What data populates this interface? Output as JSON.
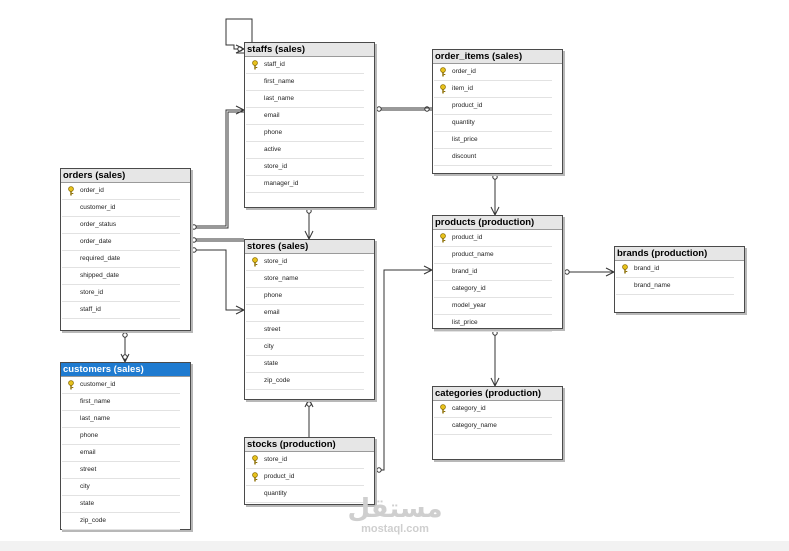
{
  "diagram": {
    "tables": [
      {
        "id": "staffs",
        "title": "staffs (sales)",
        "selected": false,
        "columns": [
          {
            "name": "staff_id",
            "pk": true
          },
          {
            "name": "first_name",
            "pk": false
          },
          {
            "name": "last_name",
            "pk": false
          },
          {
            "name": "email",
            "pk": false
          },
          {
            "name": "phone",
            "pk": false
          },
          {
            "name": "active",
            "pk": false
          },
          {
            "name": "store_id",
            "pk": false
          },
          {
            "name": "manager_id",
            "pk": false
          }
        ]
      },
      {
        "id": "order_items",
        "title": "order_items (sales)",
        "selected": false,
        "columns": [
          {
            "name": "order_id",
            "pk": true
          },
          {
            "name": "item_id",
            "pk": true
          },
          {
            "name": "product_id",
            "pk": false
          },
          {
            "name": "quantity",
            "pk": false
          },
          {
            "name": "list_price",
            "pk": false
          },
          {
            "name": "discount",
            "pk": false
          }
        ]
      },
      {
        "id": "orders",
        "title": "orders (sales)",
        "selected": false,
        "columns": [
          {
            "name": "order_id",
            "pk": true
          },
          {
            "name": "customer_id",
            "pk": false
          },
          {
            "name": "order_status",
            "pk": false
          },
          {
            "name": "order_date",
            "pk": false
          },
          {
            "name": "required_date",
            "pk": false
          },
          {
            "name": "shipped_date",
            "pk": false
          },
          {
            "name": "store_id",
            "pk": false
          },
          {
            "name": "staff_id",
            "pk": false
          }
        ]
      },
      {
        "id": "stores",
        "title": "stores (sales)",
        "selected": false,
        "columns": [
          {
            "name": "store_id",
            "pk": true
          },
          {
            "name": "store_name",
            "pk": false
          },
          {
            "name": "phone",
            "pk": false
          },
          {
            "name": "email",
            "pk": false
          },
          {
            "name": "street",
            "pk": false
          },
          {
            "name": "city",
            "pk": false
          },
          {
            "name": "state",
            "pk": false
          },
          {
            "name": "zip_code",
            "pk": false
          }
        ]
      },
      {
        "id": "products",
        "title": "products (production)",
        "selected": false,
        "columns": [
          {
            "name": "product_id",
            "pk": true
          },
          {
            "name": "product_name",
            "pk": false
          },
          {
            "name": "brand_id",
            "pk": false
          },
          {
            "name": "category_id",
            "pk": false
          },
          {
            "name": "model_year",
            "pk": false
          },
          {
            "name": "list_price",
            "pk": false
          }
        ]
      },
      {
        "id": "brands",
        "title": "brands (production)",
        "selected": false,
        "columns": [
          {
            "name": "brand_id",
            "pk": true
          },
          {
            "name": "brand_name",
            "pk": false
          }
        ]
      },
      {
        "id": "customers",
        "title": "customers (sales)",
        "selected": true,
        "columns": [
          {
            "name": "customer_id",
            "pk": true
          },
          {
            "name": "first_name",
            "pk": false
          },
          {
            "name": "last_name",
            "pk": false
          },
          {
            "name": "phone",
            "pk": false
          },
          {
            "name": "email",
            "pk": false
          },
          {
            "name": "street",
            "pk": false
          },
          {
            "name": "city",
            "pk": false
          },
          {
            "name": "state",
            "pk": false
          },
          {
            "name": "zip_code",
            "pk": false
          }
        ]
      },
      {
        "id": "categories",
        "title": "categories (production)",
        "selected": false,
        "columns": [
          {
            "name": "category_id",
            "pk": true
          },
          {
            "name": "category_name",
            "pk": false
          }
        ]
      },
      {
        "id": "stocks",
        "title": "stocks (production)",
        "selected": false,
        "columns": [
          {
            "name": "store_id",
            "pk": true
          },
          {
            "name": "product_id",
            "pk": true
          },
          {
            "name": "quantity",
            "pk": false
          }
        ]
      }
    ],
    "relationships": [
      {
        "from": "staffs",
        "to": "staffs"
      },
      {
        "from": "staffs",
        "to": "order_items"
      },
      {
        "from": "staffs",
        "to": "orders"
      },
      {
        "from": "staffs",
        "to": "stores"
      },
      {
        "from": "orders",
        "to": "stores"
      },
      {
        "from": "orders",
        "to": "customers"
      },
      {
        "from": "order_items",
        "to": "products"
      },
      {
        "from": "products",
        "to": "brands"
      },
      {
        "from": "products",
        "to": "categories"
      },
      {
        "from": "stores",
        "to": "stocks"
      },
      {
        "from": "products",
        "to": "stocks"
      }
    ],
    "colors": {
      "selected_header": "#1f7bd0",
      "header": "#e6e6e6",
      "border": "#4a4a4a",
      "line": "#333333",
      "key": "#e8c21c"
    }
  },
  "watermark": {
    "arabic": "مستقل",
    "latin": "mostaql.com"
  }
}
